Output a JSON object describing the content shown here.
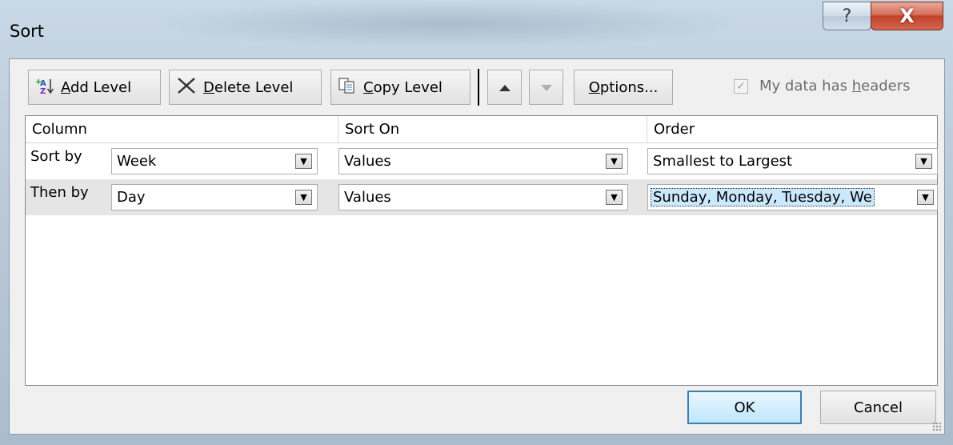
{
  "window": {
    "title": "Sort"
  },
  "title_buttons": {
    "help": "?",
    "close": "X"
  },
  "toolbar": {
    "add_level_prefix": "",
    "add_level_u": "A",
    "add_level_rest": "dd Level",
    "delete_level_u": "D",
    "delete_level_rest": "elete Level",
    "copy_level_u": "C",
    "copy_level_rest": "opy Level",
    "options_u": "O",
    "options_rest": "ptions...",
    "headers_text": "My data has ",
    "headers_u": "h",
    "headers_rest": "eaders",
    "headers_checked": true
  },
  "grid": {
    "columns": [
      "Column",
      "Sort On",
      "Order"
    ],
    "rows": [
      {
        "label": "Sort by",
        "column": "Week",
        "sort_on": "Values",
        "order": "Smallest to Largest",
        "selected": false
      },
      {
        "label": "Then by",
        "column": "Day",
        "sort_on": "Values",
        "order": "Sunday, Monday, Tuesday, We",
        "selected": true
      }
    ]
  },
  "buttons": {
    "ok": "OK",
    "cancel": "Cancel"
  }
}
